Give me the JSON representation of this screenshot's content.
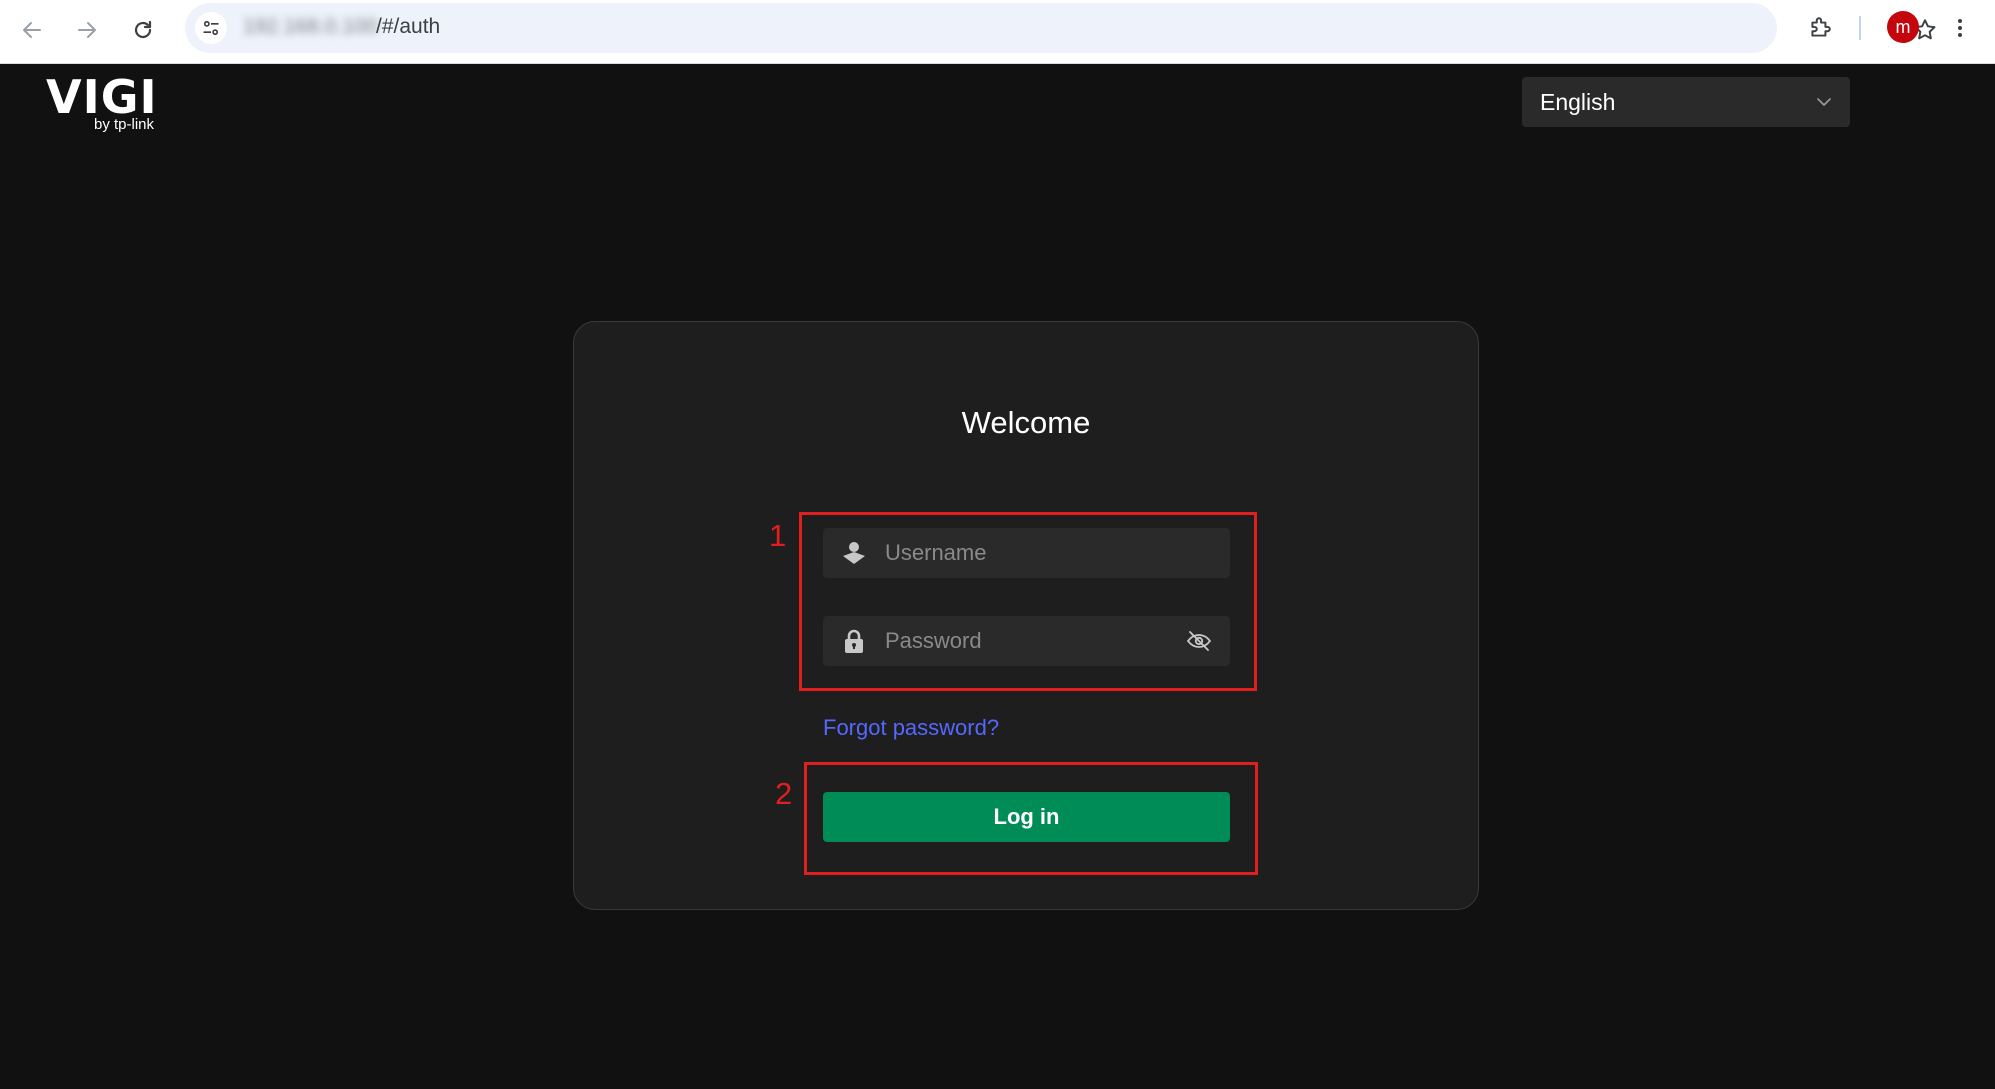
{
  "browser": {
    "url_host": "192.168.0.100",
    "url_path": "/#/auth",
    "avatar_initial": "m"
  },
  "header": {
    "logo_main": "VIGI",
    "logo_sub": "by tp-link",
    "language": "English"
  },
  "login": {
    "title": "Welcome",
    "username_placeholder": "Username",
    "password_placeholder": "Password",
    "forgot_password": "Forgot password?",
    "login_button": "Log in"
  },
  "annotations": {
    "one": "1",
    "two": "2"
  },
  "colors": {
    "accent_green": "#008c57",
    "link_blue": "#5468ff",
    "annotation_red": "#e02020",
    "background": "#111111"
  }
}
